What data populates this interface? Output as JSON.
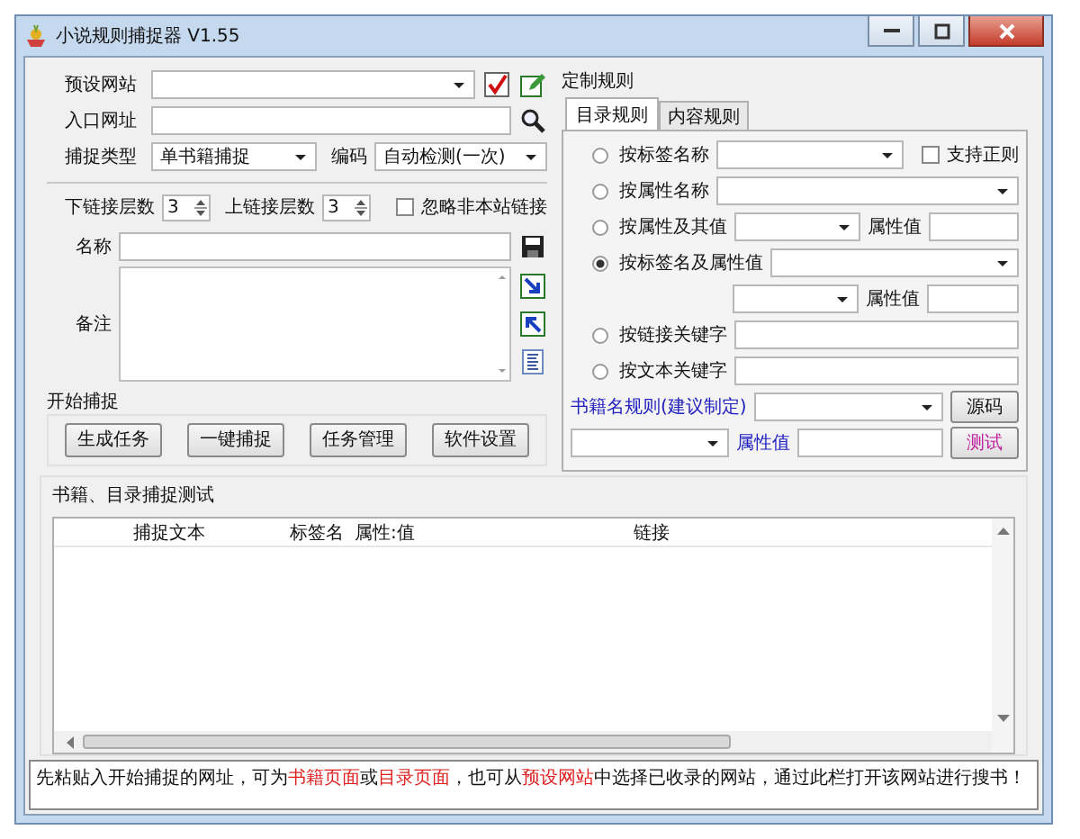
{
  "window": {
    "title": "小说规则捕捉器 V1.55"
  },
  "capture": {
    "preset_site_label": "预设网站",
    "entry_url_label": "入口网址",
    "capture_type": {
      "label": "捕捉类型",
      "value": "单书籍捕捉"
    },
    "encoding": {
      "label": "编码",
      "value": "自动检测(一次)"
    },
    "down_depth": {
      "label": "下链接层数",
      "value": "3"
    },
    "up_depth": {
      "label": "上链接层数",
      "value": "3"
    },
    "ignore_external": {
      "label": "忽略非本站链接",
      "checked": false
    },
    "name_label": "名称",
    "notes_label": "备注",
    "start_group": {
      "title": "开始捕捉",
      "buttons": [
        "生成任务",
        "一键捕捉",
        "任务管理",
        "软件设置"
      ]
    }
  },
  "rules": {
    "title": "定制规则",
    "tabs": [
      {
        "label": "目录规则",
        "selected": true
      },
      {
        "label": "内容规则",
        "selected": false
      }
    ],
    "options": [
      {
        "kind": "tag",
        "label": "按标签名称",
        "selected": false
      },
      {
        "kind": "combo",
        "label": "按属性名称",
        "selected": false
      },
      {
        "kind": "attr",
        "label": "按属性及其值",
        "selected": false,
        "attr_label": "属性值"
      },
      {
        "kind": "combo",
        "label": "按标签名及属性值",
        "selected": true
      },
      {
        "kind": "sub",
        "attr_label": "属性值"
      },
      {
        "kind": "text",
        "label": "按链接关键字",
        "selected": false
      },
      {
        "kind": "text",
        "label": "按文本关键字",
        "selected": false
      }
    ],
    "regex": {
      "label": "支持正则",
      "checked": false
    },
    "book_name_rule": {
      "label": "书籍名规则(建议制定)",
      "attr_label": "属性值",
      "buttons": [
        "源码",
        "测试"
      ]
    }
  },
  "test": {
    "title": "书籍、目录捕捉测试",
    "columns": [
      "捕捉文本",
      "标签名",
      "属性:值",
      "链接"
    ]
  },
  "status": [
    {
      "text": "先粘贴入开始捕捉的网址，可为",
      "highlight": false
    },
    {
      "text": "书籍页面",
      "highlight": true
    },
    {
      "text": "或",
      "highlight": false
    },
    {
      "text": "目录页面",
      "highlight": true
    },
    {
      "text": "，也可从",
      "highlight": false
    },
    {
      "text": "预设网站",
      "highlight": true
    },
    {
      "text": "中选择已收录的网站，通过此栏打开该网站进行搜书！",
      "highlight": false
    }
  ]
}
